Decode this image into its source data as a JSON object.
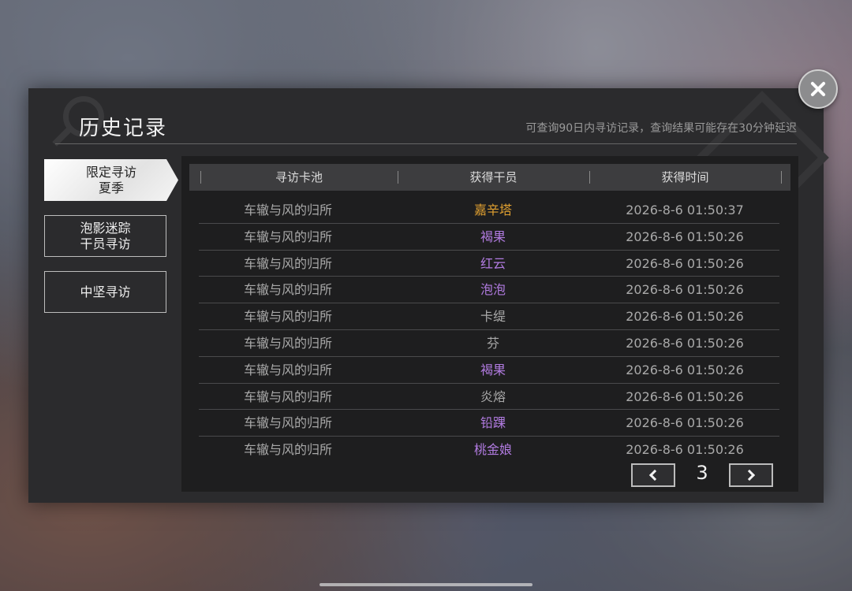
{
  "title": "历史记录",
  "note": "可查询90日内寻访记录，查询结果可能存在30分钟延迟",
  "tabs": [
    {
      "label": "限定寻访\n夏季",
      "active": true
    },
    {
      "label": "泡影迷踪\n干员寻访",
      "active": false
    },
    {
      "label": "中坚寻访",
      "active": false
    }
  ],
  "columns": [
    "寻访卡池",
    "获得干员",
    "获得时间"
  ],
  "rows": [
    {
      "pool": "车辙与风的归所",
      "operator": "嘉辛塔",
      "time": "2026-8-6 01:50:37",
      "rarity_color": "#e0a030"
    },
    {
      "pool": "车辙与风的归所",
      "operator": "褐果",
      "time": "2026-8-6 01:50:26",
      "rarity_color": "#b17be0"
    },
    {
      "pool": "车辙与风的归所",
      "operator": "红云",
      "time": "2026-8-6 01:50:26",
      "rarity_color": "#b17be0"
    },
    {
      "pool": "车辙与风的归所",
      "operator": "泡泡",
      "time": "2026-8-6 01:50:26",
      "rarity_color": "#b17be0"
    },
    {
      "pool": "车辙与风的归所",
      "operator": "卡缇",
      "time": "2026-8-6 01:50:26",
      "rarity_color": "#a9a9a9"
    },
    {
      "pool": "车辙与风的归所",
      "operator": "芬",
      "time": "2026-8-6 01:50:26",
      "rarity_color": "#a9a9a9"
    },
    {
      "pool": "车辙与风的归所",
      "operator": "褐果",
      "time": "2026-8-6 01:50:26",
      "rarity_color": "#b17be0"
    },
    {
      "pool": "车辙与风的归所",
      "operator": "炎熔",
      "time": "2026-8-6 01:50:26",
      "rarity_color": "#a9a9a9"
    },
    {
      "pool": "车辙与风的归所",
      "operator": "铅踝",
      "time": "2026-8-6 01:50:26",
      "rarity_color": "#b17be0"
    },
    {
      "pool": "车辙与风的归所",
      "operator": "桃金娘",
      "time": "2026-8-6 01:50:26",
      "rarity_color": "#b17be0"
    }
  ],
  "pager": {
    "page": "3",
    "prev_icon": "chevron-left-icon",
    "next_icon": "chevron-right-icon"
  },
  "close_icon": "close-icon"
}
